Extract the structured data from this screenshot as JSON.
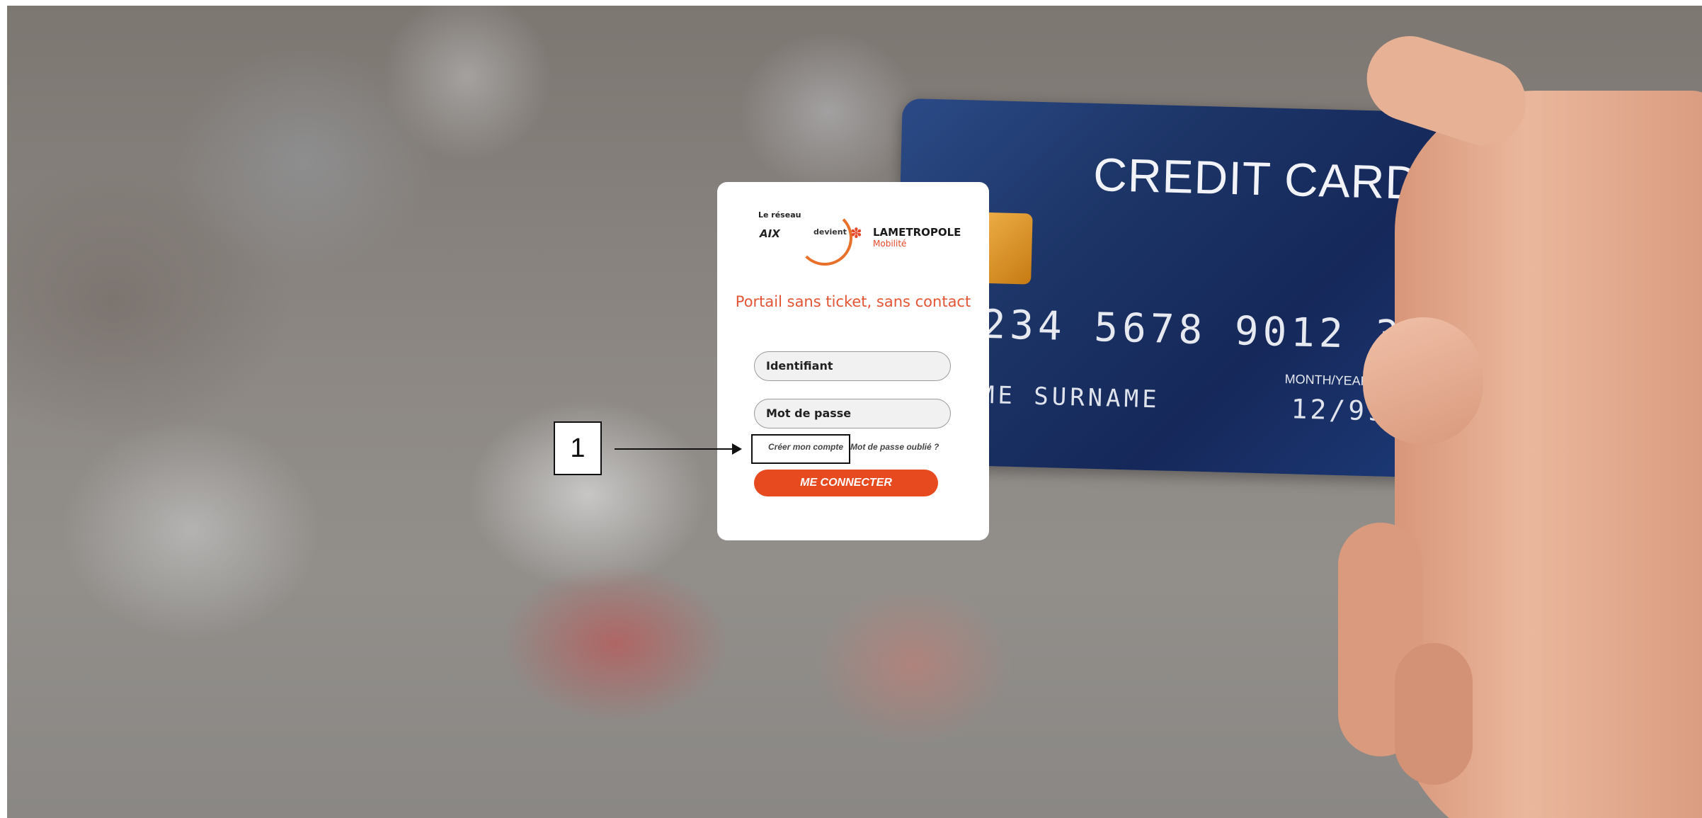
{
  "background": {
    "credit_card": {
      "title": "CREDIT CARD",
      "number": "234 5678 9012 345",
      "name": "ME SURNAME",
      "expiry_label": "MONTH/YEAR",
      "expiry": "12/99"
    }
  },
  "logo": {
    "small": "Le réseau",
    "aix": "AIX",
    "devient": "devient",
    "metropole": "LAMETROPOLE",
    "mobilite": "Mobilité"
  },
  "login": {
    "title": "Portail sans ticket, sans contact",
    "identifier_placeholder": "Identifiant",
    "password_placeholder": "Mot de passe",
    "create_account": "Créer mon compte",
    "forgot_password": "Mot de passe oublié ?",
    "connect_button": "ME CONNECTER"
  },
  "annotation": {
    "label": "1"
  },
  "colors": {
    "accent": "#e64a1e",
    "title": "#e35535"
  }
}
